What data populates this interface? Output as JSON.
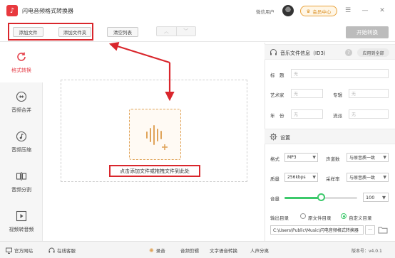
{
  "app": {
    "title": "闪电音频格式转换器",
    "user_label": "微信用户",
    "member_label": "会员中心"
  },
  "toolbar": {
    "add_file": "添加文件",
    "add_folder": "添加文件夹",
    "clear_list": "清空列表",
    "start": "开始转换"
  },
  "sidebar": {
    "items": [
      {
        "label": "格式转换",
        "icon": "refresh-icon",
        "active": true
      },
      {
        "label": "音频合并",
        "icon": "merge-icon"
      },
      {
        "label": "音频压缩",
        "icon": "music-note-icon"
      },
      {
        "label": "音频分割",
        "icon": "split-icon"
      },
      {
        "label": "视频转音频",
        "icon": "play-icon"
      }
    ]
  },
  "drop": {
    "label": "点击添加文件或拖拽文件到此处"
  },
  "info": {
    "title": "音乐文件信息（ID3）",
    "apply_all": "应用到全部",
    "title_label": "标　题",
    "artist_label": "艺术家",
    "album_label": "专辑",
    "year_label": "年　份",
    "genre_label": "流派",
    "empty": "无"
  },
  "settings": {
    "title": "设置",
    "format_label": "格式",
    "format_value": "MP3",
    "channel_label": "声道数",
    "channel_value": "与原音质一致",
    "quality_label": "质量",
    "quality_value": "256kbps",
    "sample_label": "采样率",
    "sample_value": "与原音质一致",
    "volume_label": "音量",
    "volume_value": "100",
    "volume_fraction": 0.5,
    "output_label": "输出目录",
    "source_dir": "原文件目录",
    "custom_dir": "自定义目录",
    "path": "C:\\Users\\Public\\Music\\闪电音频格式转换器",
    "more": "···"
  },
  "footer": {
    "website": "官方网站",
    "support": "在线客服",
    "record": "录音",
    "cut": "音频剪辑",
    "tts": "文字语音转换",
    "vocal": "人声分离",
    "version": "版本号：v4.0.1"
  },
  "colors": {
    "accent_red": "#e5404a",
    "annotation_red": "#d9262c",
    "green": "#3cc96b",
    "orange": "#e0a45a"
  }
}
